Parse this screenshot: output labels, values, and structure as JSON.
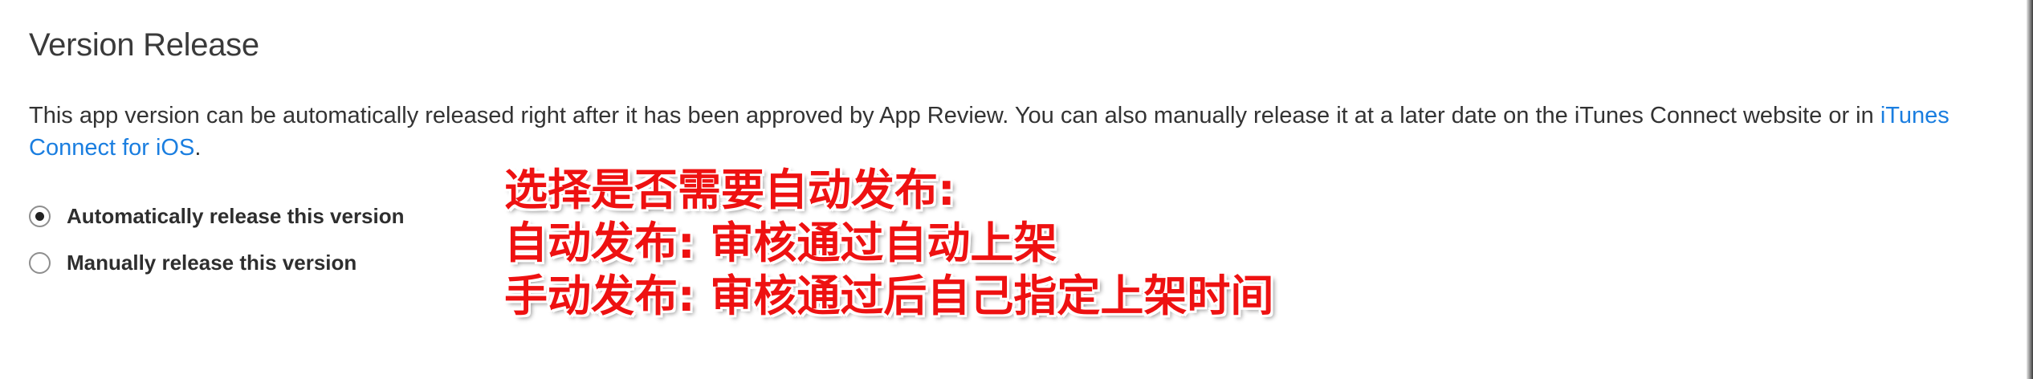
{
  "section": {
    "title": "Version Release",
    "description_text": "This app version can be automatically released right after it has been approved by App Review. You can also manually release it at a later date on the iTunes Connect website or in ",
    "description_link": "iTunes Connect for iOS",
    "description_end": "."
  },
  "release_options": [
    {
      "label": "Automatically release this version",
      "selected": true
    },
    {
      "label": "Manually release this version",
      "selected": false
    }
  ],
  "annotation": {
    "line1": "选择是否需要自动发布:",
    "line2": "自动发布: 审核通过自动上架",
    "line3": "手动发布: 审核通过后自己指定上架时间",
    "color": "#ee1111"
  },
  "colors": {
    "link": "#1a7ee0",
    "text": "#333333"
  }
}
